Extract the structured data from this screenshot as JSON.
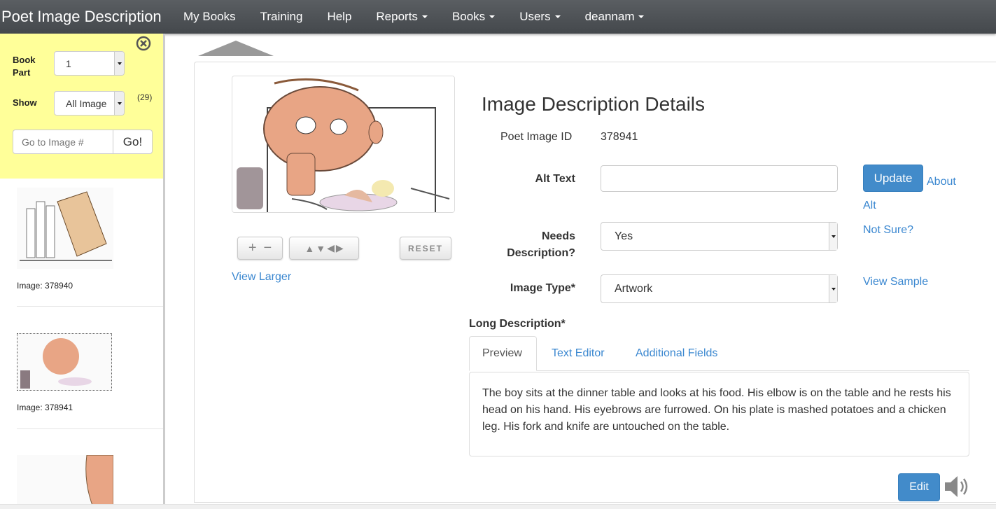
{
  "navbar": {
    "brand": "Poet Image Description",
    "items": [
      {
        "label": "My Books",
        "dropdown": false
      },
      {
        "label": "Training",
        "dropdown": false
      },
      {
        "label": "Help",
        "dropdown": false
      },
      {
        "label": "Reports",
        "dropdown": true
      },
      {
        "label": "Books",
        "dropdown": true
      },
      {
        "label": "Users",
        "dropdown": true
      },
      {
        "label": "deannam",
        "dropdown": true
      }
    ]
  },
  "sidebar": {
    "book_part_label": "Book Part",
    "book_part_value": "1",
    "show_label": "Show",
    "show_value": "All Image",
    "count": "(29)",
    "goto_placeholder": "Go to Image #",
    "go_label": "Go!",
    "thumbnails": [
      {
        "caption": "Image: 378940"
      },
      {
        "caption": "Image: 378941"
      }
    ]
  },
  "viewer": {
    "reset_label": "RESET",
    "view_larger": "View Larger"
  },
  "details": {
    "title": "Image Description Details",
    "id_label": "Poet Image ID",
    "id_value": "378941",
    "alt_label": "Alt Text",
    "alt_value": "",
    "update_label": "Update",
    "about_alt": "About Alt",
    "needs_label": "Needs Description?",
    "needs_value": "Yes",
    "not_sure": "Not Sure?",
    "type_label": "Image Type*",
    "type_value": "Artwork",
    "view_sample": "View Sample",
    "long_label": "Long Description*",
    "tabs": [
      {
        "label": "Preview",
        "active": true
      },
      {
        "label": "Text Editor",
        "active": false
      },
      {
        "label": "Additional Fields",
        "active": false
      }
    ],
    "preview_text": "The boy sits at the dinner table and looks at his food. His elbow is on the table and he rests his head on his hand. His eyebrows are furrowed. On his plate is mashed potatoes and a chicken leg. His fork and knife are untouched on the table.",
    "edit_label": "Edit"
  },
  "colors": {
    "accent": "#428bca",
    "sidebar_bg": "#ffff99",
    "navbar": "#4f5357"
  }
}
